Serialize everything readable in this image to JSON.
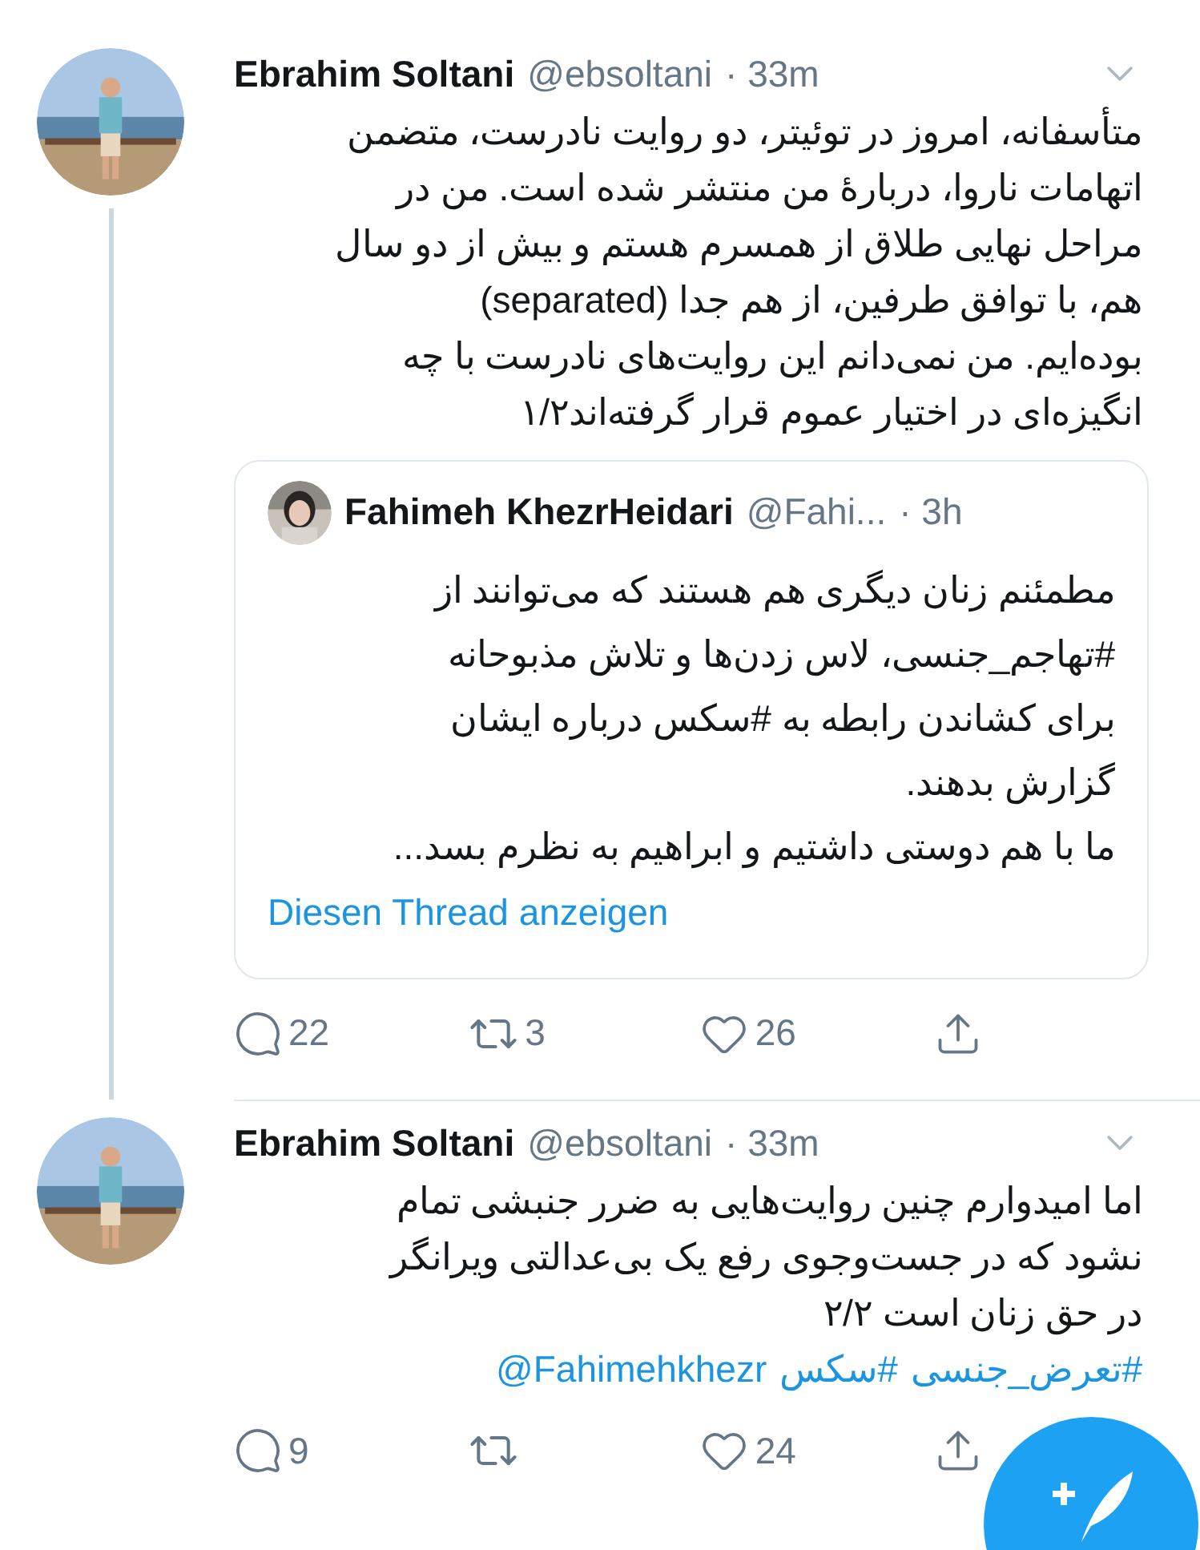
{
  "tweets": [
    {
      "name": "Ebrahim Soltani",
      "handle": "@ebsoltani",
      "time": "· 33m",
      "body_lines": [
        "متأسفانه، امروز در توئیتر، دو روایت نادرست، متضمن",
        "اتهامات ناروا، دربارهٔ من منتشر شده است. من در",
        "مراحل نهایی طلاق از همسرم هستم و بیش از دو سال",
        "هم، با توافق طرفین، از هم جدا (separated)",
        "بوده‌ایم. من نمی‌دانم این روایت‌های نادرست با چه",
        "انگیزه‌ای در اختیار عموم قرار گرفته‌اند۱/۲"
      ],
      "quote": {
        "name": "Fahimeh KhezrHeidari",
        "handle": "@Fahi...",
        "time": "· 3h",
        "body_lines": [
          "مطمئنم زنان دیگری هم هستند که می‌توانند از",
          "#تهاجم_جنسی، لاس زدن‌ها و تلاش مذبوحانه",
          "برای کشاندن رابطه به #سکس درباره ایشان",
          "گزارش بدهند.",
          "ما با هم دوستی داشتیم و ابراهیم به نظرم بسد..."
        ],
        "link": "Diesen Thread anzeigen"
      },
      "actions": {
        "replies": "22",
        "retweets": "3",
        "likes": "26"
      }
    },
    {
      "name": "Ebrahim Soltani",
      "handle": "@ebsoltani",
      "time": "· 33m",
      "body_lines": [
        "اما امیدوارم چنین روایت‌هایی به ضرر جنبشی تمام",
        "نشود که در جست‌وجوی رفع یک بی‌عدالتی ویرانگر",
        "در حق زنان است ۲/۲"
      ],
      "links": [
        "#تعرض_جنسی",
        "#سکس",
        "@Fahimehkhezr"
      ],
      "actions": {
        "replies": "9",
        "likes": "24"
      }
    }
  ]
}
